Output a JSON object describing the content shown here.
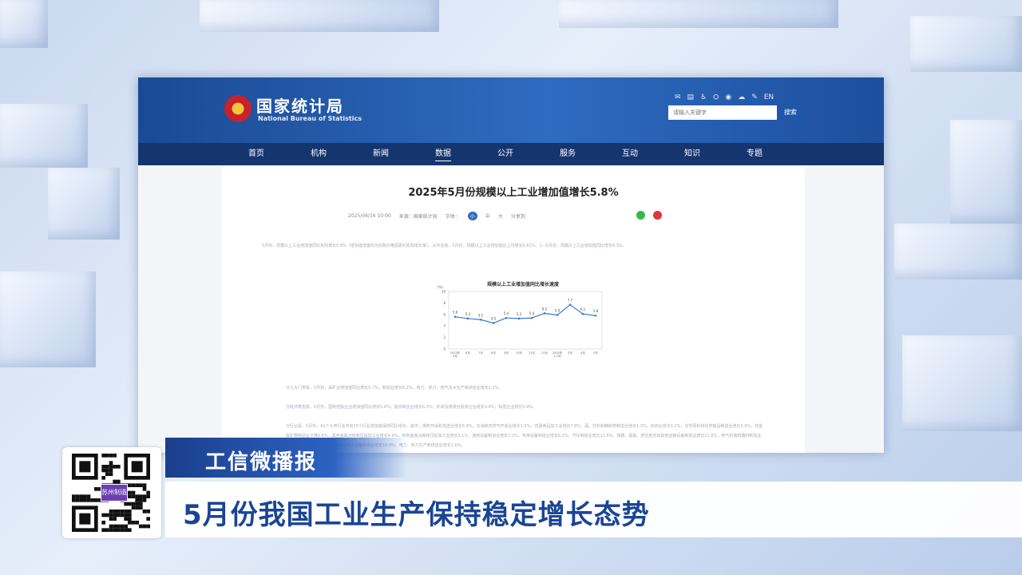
{
  "site": {
    "name_cn": "国家统计局",
    "name_en": "National Bureau of Statistics",
    "search_placeholder": "请输入关键字",
    "search_button": "搜索",
    "top_icons": [
      "mail-icon",
      "reader-icon",
      "accessibility-icon",
      "elder-icon",
      "weibo-icon",
      "wechat-icon",
      "message-icon",
      "EN"
    ],
    "nav": [
      "首页",
      "机构",
      "新闻",
      "数据",
      "公开",
      "服务",
      "互动",
      "知识",
      "专题"
    ],
    "nav_active": "数据"
  },
  "article": {
    "title": "2025年5月份规模以上工业增加值增长5.8%",
    "date": "2025/06/16 10:00",
    "source": "来源：国家统计局",
    "font_label": "字体：",
    "size_small": "小",
    "size_medium": "中",
    "size_large": "大",
    "share_label": "分享到",
    "para1": "5月份，规模以上工业增加值同比实际增长5.8%（增加值增速均为扣除价格因素的实际增长率）。从环比看，5月份，规模以上工业增加值比上月增长0.61%。1—5月份，规模以上工业增加值同比增长6.3%。",
    "para2": "分三大门类看，5月份，采矿业增加值同比增长5.7%，制造业增长6.2%，电力、热力、燃气及水生产和供应业增长2.2%。",
    "para3": "分经济类型看，5月份，国有控股企业增加值同比增长5.6%；股份制企业增长6.3%，外商及港澳台投资企业增长3.9%；私营企业增长5.9%。",
    "para4": "分行业看，5月份，41个大类行业中有35个行业增加值保持同比增长。其中，煤炭开采和洗选业增长5.9%，石油和天然气开采业增长1.5%，农副食品加工业增长7.6%，酒、饮料和精制茶制造业增长1.3%，纺织业增长1.2%，化学原料和化学制品制造业增长3.9%，非金属矿物制品业下降0.6%，黑色金属冶炼和压延加工业增长4.9%，有色金属冶炼和压延加工业增长3.1%，通用设备制造业增长7.2%，专用设备制造业增长6.2%，汽车制造业增长11.6%，铁路、船舶、航空航天和其他运输设备制造业增长11.6%，电气机械和器材制造业增长11.0%，计算机、通信和其他电子设备制造业增长10.0%，电力、热力生产和供应业增长1.6%。"
  },
  "chart_data": {
    "type": "line",
    "title": "规模以上工业增加值同比增长速度",
    "ylabel": "(%)",
    "ylim": [
      0,
      10
    ],
    "yticks": [
      0,
      2,
      4,
      6,
      8,
      10
    ],
    "categories": [
      "2024年5月",
      "6月",
      "7月",
      "8月",
      "9月",
      "10月",
      "11月",
      "12月",
      "2025年1-2月",
      "3月",
      "4月",
      "5月"
    ],
    "x_tick_labels": [
      "2024年\n5月",
      "6月",
      "7月",
      "8月",
      "9月",
      "10月",
      "11月",
      "12月",
      "2025年\n1-2月",
      "3月",
      "4月",
      "5月"
    ],
    "values": [
      5.6,
      5.3,
      5.1,
      4.5,
      5.4,
      5.3,
      5.4,
      6.2,
      5.9,
      7.7,
      6.1,
      5.8
    ],
    "grid": false,
    "color": "#3a7cc8"
  },
  "overlay": {
    "program_name": "工信微播报",
    "headline": "5月份我国工业生产保持稳定增长态势",
    "qr_label": "苏州制造"
  },
  "colors": {
    "header_blue": "#1a4a95",
    "nav_dark": "#15356f",
    "headline_blue": "#1a4595"
  }
}
